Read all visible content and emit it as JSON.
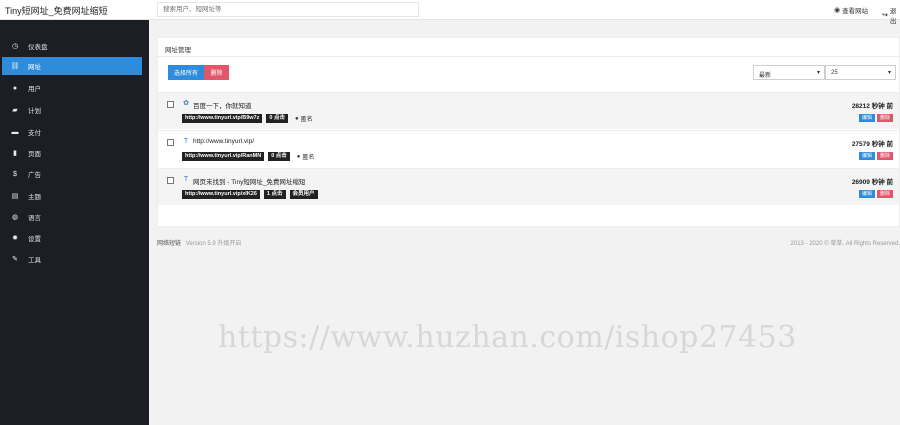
{
  "app": {
    "title": "Tiny短网址_免费网址缩短"
  },
  "search": {
    "placeholder": "搜索用户、短网址等"
  },
  "topnav": {
    "items": [
      {
        "icon": "globe-icon",
        "label": "查看网站"
      },
      {
        "icon": "logout-icon",
        "label": "退出"
      }
    ]
  },
  "sidebar": {
    "items": [
      {
        "icon": "dashboard-icon",
        "label": "仪表盘",
        "active": false
      },
      {
        "icon": "link-icon",
        "label": "网址",
        "active": true
      },
      {
        "icon": "user-icon",
        "label": "用户",
        "active": false
      },
      {
        "icon": "plan-icon",
        "label": "计划",
        "active": false
      },
      {
        "icon": "payment-icon",
        "label": "支付",
        "active": false
      },
      {
        "icon": "page-icon",
        "label": "页面",
        "active": false
      },
      {
        "icon": "dollar-icon",
        "label": "广告",
        "active": false
      },
      {
        "icon": "theme-icon",
        "label": "主题",
        "active": false
      },
      {
        "icon": "language-icon",
        "label": "语言",
        "active": false
      },
      {
        "icon": "settings-icon",
        "label": "设置",
        "active": false
      },
      {
        "icon": "tools-icon",
        "label": "工具",
        "active": false
      }
    ]
  },
  "panel": {
    "title": "网址管理",
    "select_all_label": "选择所有",
    "delete_label": "删除",
    "sort_value": "最新",
    "per_page_value": "25"
  },
  "urls": [
    {
      "favicon": "baidu-icon",
      "title": "百度一下，你就知道",
      "short_url": "http://www.tinyurl.vip/B9w7z",
      "clicks": "0 点击",
      "author": "匿名",
      "time": "28212 秒钟 前",
      "edit_label": "编辑",
      "delete_label": "删除"
    },
    {
      "favicon": "tiny-icon",
      "title": "http://www.tinyurl.vip/",
      "short_url": "http://www.tinyurl.vip/RanMN",
      "clicks": "0 点击",
      "author": "匿名",
      "time": "27579 秒钟 前",
      "edit_label": "编辑",
      "delete_label": "删除"
    },
    {
      "favicon": "tiny-icon",
      "title": "网页未找到 - Tiny短网址_免费网址缩短",
      "short_url": "http://www.tinyurl.vip/xIK26",
      "clicks": "1 点击",
      "author": "会员用户",
      "time": "26909 秒钟 前",
      "edit_label": "编辑",
      "delete_label": "删除"
    }
  ],
  "footer": {
    "left_label": "网络短链",
    "version": "Version 5.9 升级开启",
    "right": "2013 - 2020 © 草草. All Rights Reserved."
  },
  "watermark": {
    "text": "https://www.huzhan.com/ishop27453"
  },
  "colors": {
    "sidebar_bg": "#1b1e24",
    "accent": "#2d8ddc",
    "danger": "#e2566b",
    "tag_bg": "#222222"
  }
}
